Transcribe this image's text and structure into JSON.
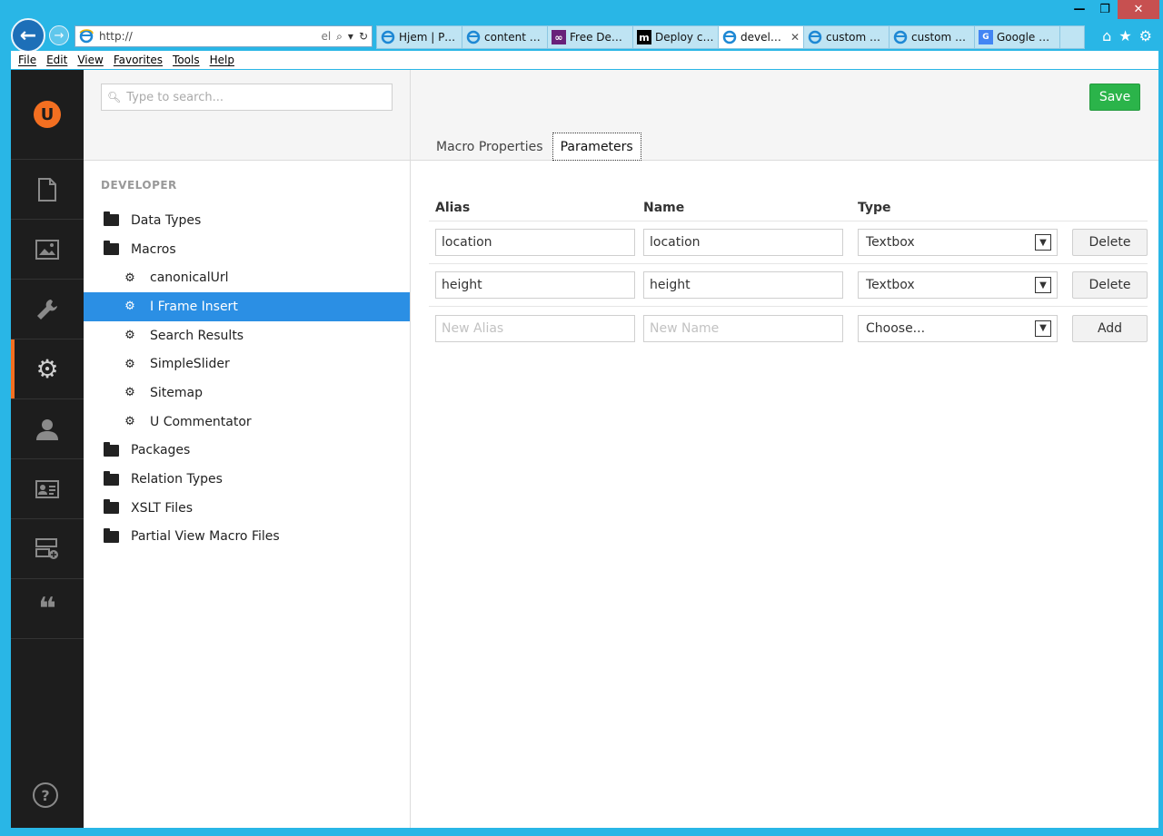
{
  "browser": {
    "url": "http://",
    "url_suffix": "el",
    "tabs": [
      {
        "label": "Hjem | Pro...",
        "icon": "ie-icon",
        "active": false
      },
      {
        "label": "content - ...",
        "icon": "ie-icon",
        "active": false
      },
      {
        "label": "Free Dev T...",
        "icon": "visual-studio-icon",
        "active": false
      },
      {
        "label": "Deploy co...",
        "icon": "m-icon",
        "active": false
      },
      {
        "label": "develo...",
        "icon": "ie-icon",
        "active": true,
        "close": "✕"
      },
      {
        "label": "custom gri...",
        "icon": "ie-icon",
        "active": false
      },
      {
        "label": "custom gr...",
        "icon": "ie-icon",
        "active": false
      },
      {
        "label": "Google Ov...",
        "icon": "google-translate-icon",
        "active": false
      }
    ],
    "menu": [
      "File",
      "Edit",
      "View",
      "Favorites",
      "Tools",
      "Help"
    ],
    "window_controls": {
      "minimize": "—",
      "restore": "❐",
      "close": "✕"
    }
  },
  "sidebar": {
    "logo": "U",
    "sections": [
      {
        "name": "content",
        "icon": "document-icon",
        "glyph": "🗋"
      },
      {
        "name": "media",
        "icon": "image-icon",
        "glyph": "🖼"
      },
      {
        "name": "settings",
        "icon": "wrench-icon",
        "glyph": "🔧"
      },
      {
        "name": "developer",
        "icon": "gear-icon",
        "glyph": "⚙",
        "active": true
      },
      {
        "name": "users",
        "icon": "user-icon",
        "glyph": "👤"
      },
      {
        "name": "members",
        "icon": "id-card-icon",
        "glyph": "🪪"
      },
      {
        "name": "forms",
        "icon": "add-layout-icon",
        "glyph": "☰"
      },
      {
        "name": "translation",
        "icon": "quote-icon",
        "glyph": "❝"
      }
    ],
    "help": "?"
  },
  "tree": {
    "search_placeholder": "Type to search...",
    "title": "DEVELOPER",
    "items": [
      {
        "label": "Data Types",
        "type": "folder",
        "level": 0
      },
      {
        "label": "Macros",
        "type": "folder",
        "level": 0
      },
      {
        "label": "canonicalUrl",
        "type": "macro",
        "level": 1
      },
      {
        "label": "I Frame Insert",
        "type": "macro",
        "level": 1,
        "selected": true
      },
      {
        "label": "Search Results",
        "type": "macro",
        "level": 1
      },
      {
        "label": "SimpleSlider",
        "type": "macro",
        "level": 1
      },
      {
        "label": "Sitemap",
        "type": "macro",
        "level": 1
      },
      {
        "label": "U Commentator",
        "type": "macro",
        "level": 1
      },
      {
        "label": "Packages",
        "type": "folder",
        "level": 0
      },
      {
        "label": "Relation Types",
        "type": "folder",
        "level": 0
      },
      {
        "label": "XSLT Files",
        "type": "folder",
        "level": 0
      },
      {
        "label": "Partial View Macro Files",
        "type": "folder",
        "level": 0
      }
    ]
  },
  "editor": {
    "save_label": "Save",
    "tabs": [
      {
        "label": "Macro Properties",
        "active": false
      },
      {
        "label": "Parameters",
        "active": true
      }
    ],
    "columns": {
      "alias": "Alias",
      "name": "Name",
      "type": "Type"
    },
    "rows": [
      {
        "alias": "location",
        "name": "location",
        "type": "Textbox",
        "action": "Delete"
      },
      {
        "alias": "height",
        "name": "height",
        "type": "Textbox",
        "action": "Delete"
      }
    ],
    "new_row": {
      "alias_placeholder": "New Alias",
      "name_placeholder": "New Name",
      "type_placeholder": "Choose...",
      "action": "Add"
    }
  },
  "colors": {
    "accent": "#f36f21",
    "selected": "#2b8fe4",
    "save": "#2bb44a",
    "browser_frame": "#29b6e6"
  }
}
